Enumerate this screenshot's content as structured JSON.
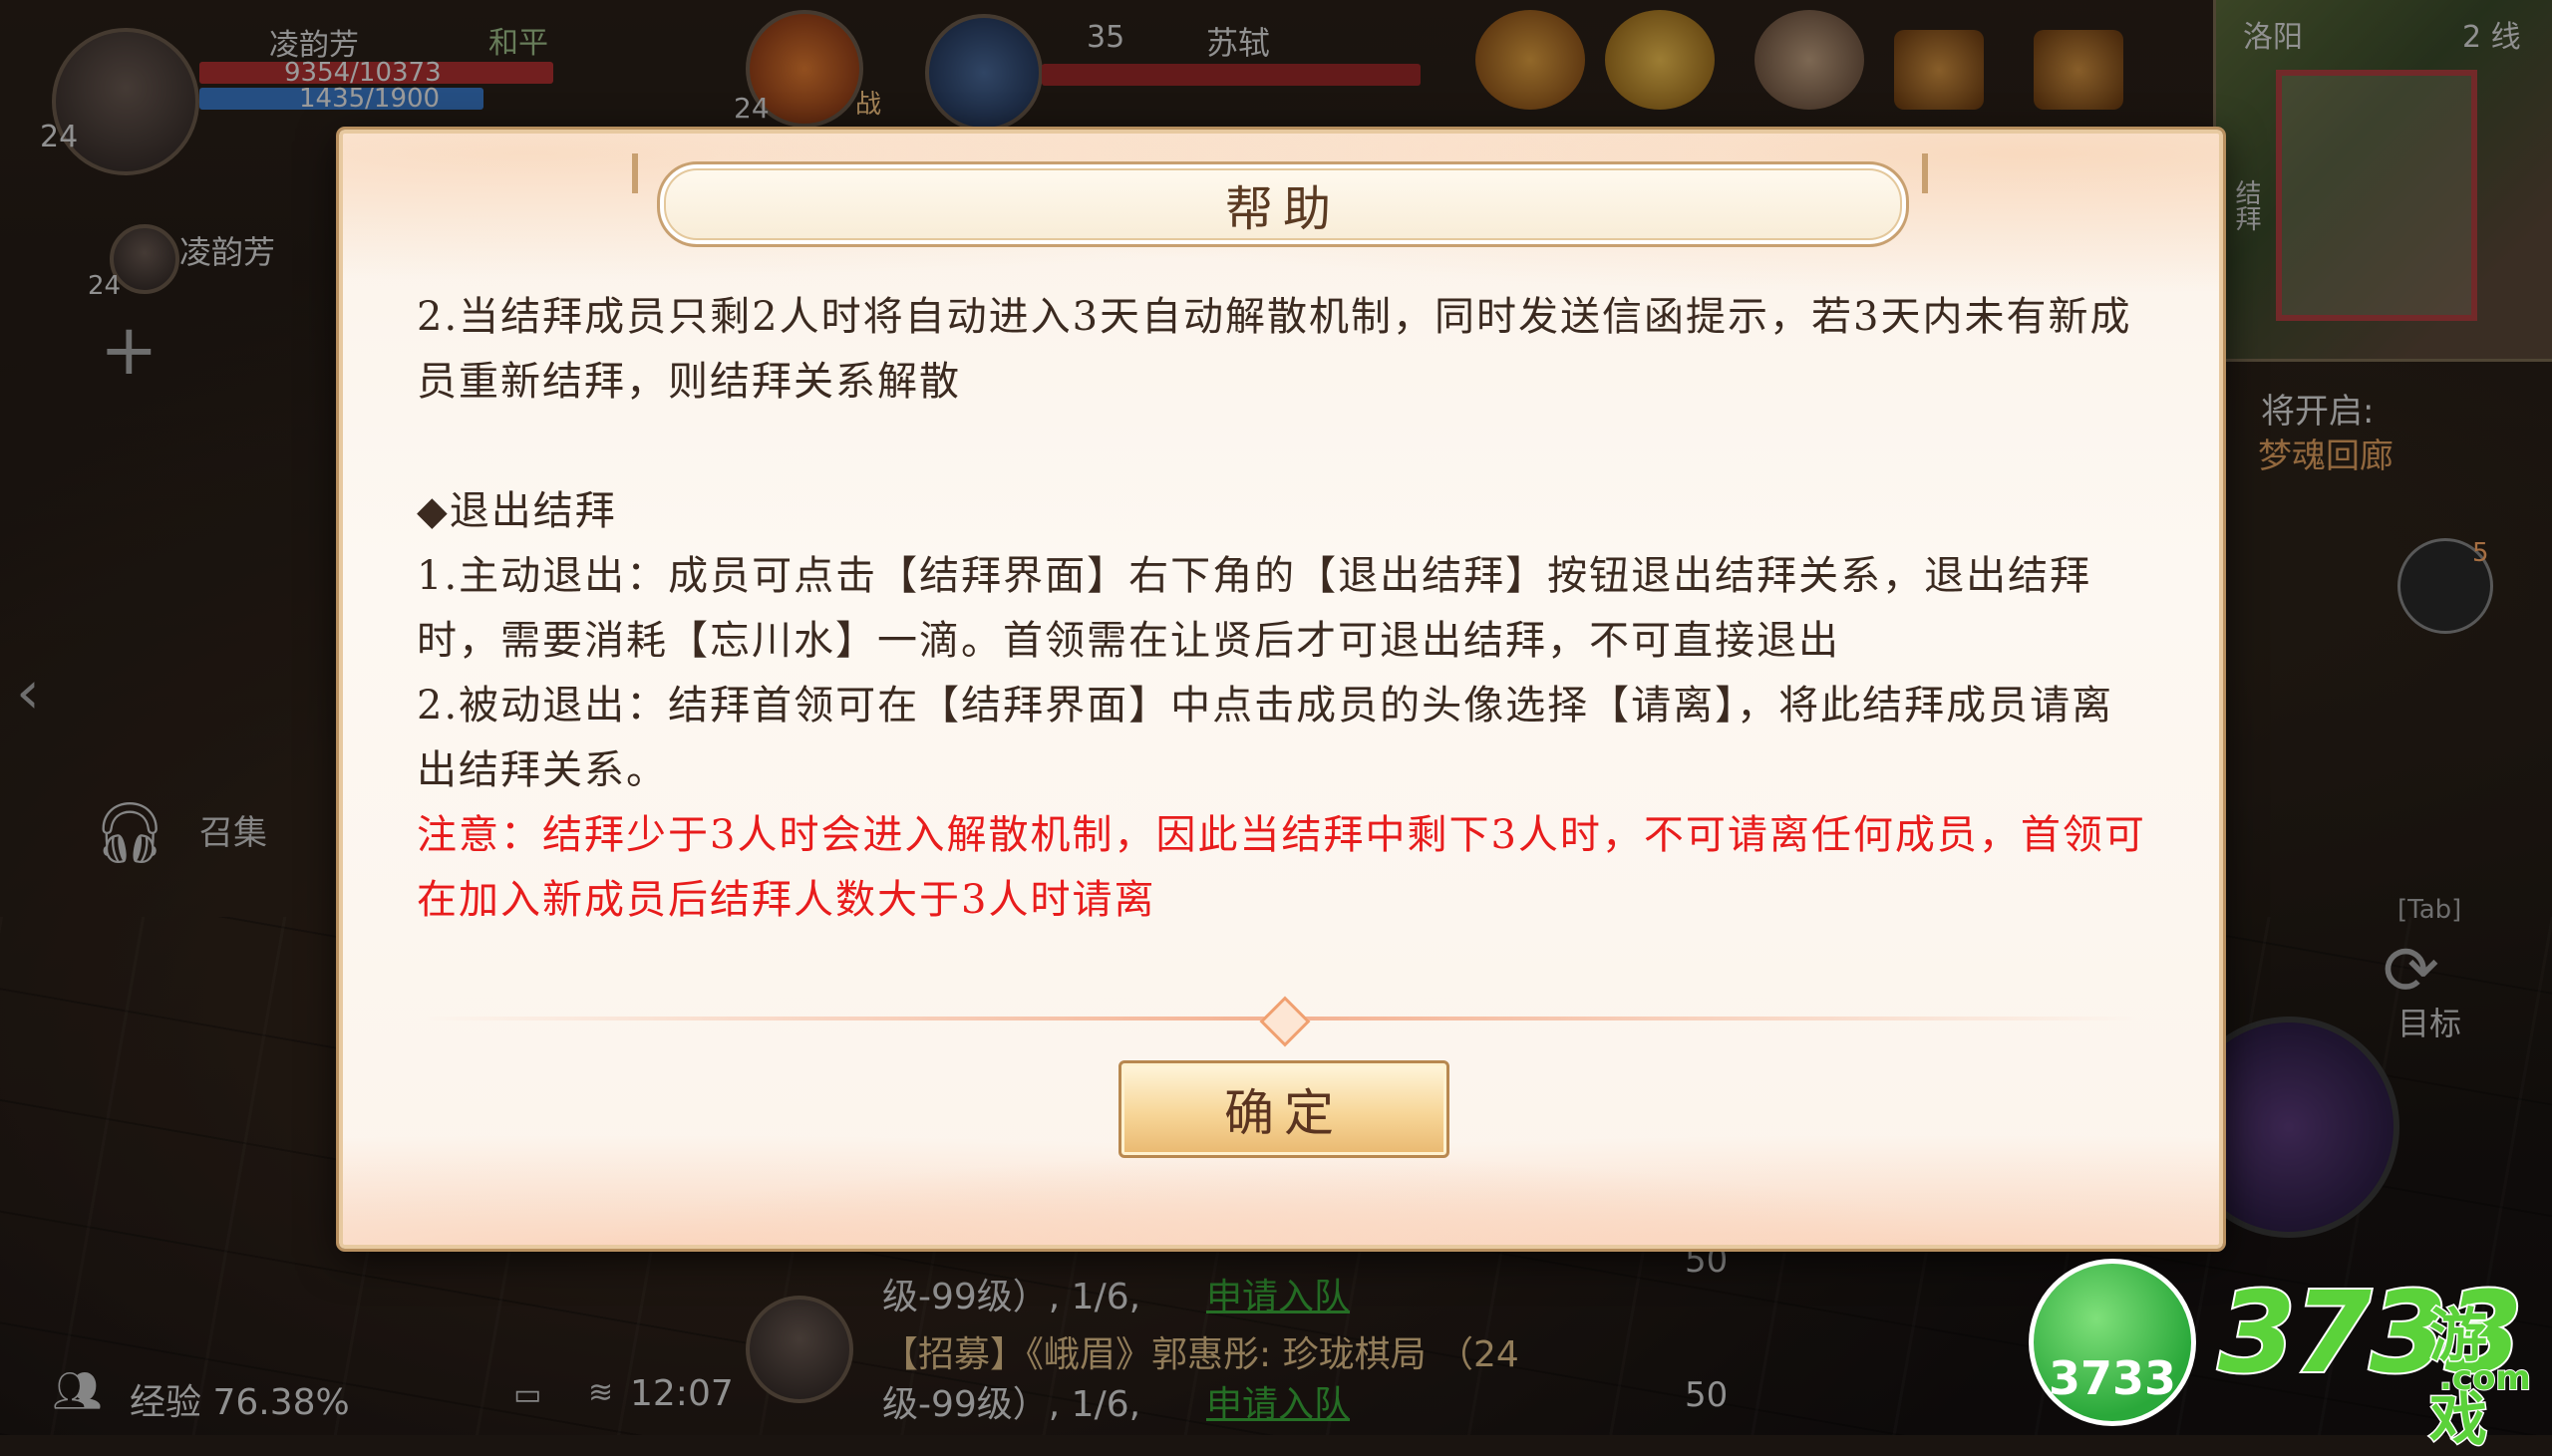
{
  "hud": {
    "player_name": "凌韵芳",
    "player_level": "24",
    "mode": "和平",
    "hp": "9354/10373",
    "mp": "1435/1900",
    "pet_level": "24",
    "pet_tag": "战",
    "target_level": "35",
    "target_name": "苏轼",
    "location": "洛阳",
    "line": "2 线",
    "team_member_name": "凌韵芳",
    "team_member_level": "24",
    "upcoming_label": "将开启:",
    "upcoming_name": "梦魂回廊",
    "minimap_side_label": "结拜",
    "summon_label": "召集",
    "tab_hint": "[Tab]",
    "target_label": "目标",
    "exp": "经验 76.38%",
    "clock": "12:07",
    "chat_line1a": "级-99级）, 1/6,",
    "chat_line1b": "申请入队",
    "chat_line2a": "【招募】《峨眉》郭惠彤: 珍珑棋局 （24",
    "chat_line2b": "级-99级）, 1/6,",
    "chat_line2c": "申请入队",
    "count1": "50",
    "count2": "50",
    "skill_badge": "5"
  },
  "dialog": {
    "title": "帮助",
    "paragraphs": [
      "2.当结拜成员只剩2人时将自动进入3天自动解散机制，同时发送信函提示，若3天内未有新成员重新结拜，则结拜关系解散",
      "◆退出结拜",
      "1.主动退出：成员可点击【结拜界面】右下角的【退出结拜】按钮退出结拜关系，退出结拜时，需要消耗【忘川水】一滴。首领需在让贤后才可退出结拜，不可直接退出",
      "2.被动退出：结拜首领可在【结拜界面】中点击成员的头像选择【请离】，将此结拜成员请离出结拜关系。"
    ],
    "warning": "注意：结拜少于3人时会进入解散机制，因此当结拜中剩下3人时，不可请离任何成员，首领可在加入新成员后结拜人数大于3人时请离",
    "ok_label": "确定"
  },
  "watermark": {
    "badge": "3733",
    "text": "3733",
    "cn": "游戏",
    "com": ".com"
  },
  "colors": {
    "warning_text": "#e81c1c",
    "body_text": "#3b2a20",
    "hp_bar": "#b03030",
    "mp_bar": "#3a78c8",
    "watermark_green": "#5bd23a"
  }
}
